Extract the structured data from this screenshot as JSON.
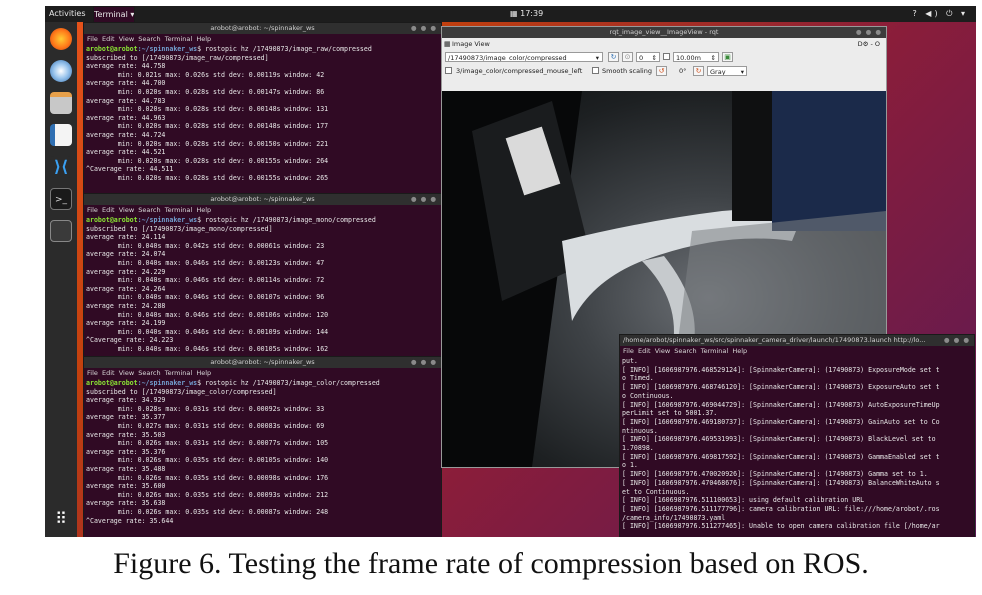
{
  "topbar": {
    "activities": "Activities",
    "terminal_menu": "Terminal ▾",
    "clock": "17:39",
    "tray": "? ◀) ⏻ ▾"
  },
  "dock": {
    "apps_grid_glyph": "⠿"
  },
  "terminal1": {
    "title": "arobot@arobot: ~/spinnaker_ws",
    "menu": "File  Edit  View  Search  Terminal  Help",
    "prompt_user": "arobot@arobot",
    "prompt_path": ":~/spinnaker_ws",
    "command": "$ rostopic hz /17490873/image_raw/compressed",
    "lines": [
      "subscribed to [/17490873/image_raw/compressed]",
      "average rate: 44.758",
      "        min: 0.021s max: 0.026s std dev: 0.00119s window: 42",
      "average rate: 44.700",
      "        min: 0.020s max: 0.028s std dev: 0.00147s window: 86",
      "average rate: 44.783",
      "        min: 0.020s max: 0.028s std dev: 0.00148s window: 131",
      "average rate: 44.963",
      "        min: 0.020s max: 0.028s std dev: 0.00148s window: 177",
      "average rate: 44.724",
      "        min: 0.020s max: 0.028s std dev: 0.00150s window: 221",
      "average rate: 44.521",
      "        min: 0.020s max: 0.028s std dev: 0.00155s window: 264",
      "^Caverage rate: 44.511",
      "        min: 0.020s max: 0.028s std dev: 0.00155s window: 265"
    ]
  },
  "terminal2": {
    "title": "arobot@arobot: ~/spinnaker_ws",
    "menu": "File  Edit  View  Search  Terminal  Help",
    "prompt_user": "arobot@arobot",
    "prompt_path": ":~/spinnaker_ws",
    "command": "$ rostopic hz /17490873/image_mono/compressed",
    "lines": [
      "subscribed to [/17490873/image_mono/compressed]",
      "average rate: 24.114",
      "        min: 0.040s max: 0.042s std dev: 0.00061s window: 23",
      "average rate: 24.074",
      "        min: 0.040s max: 0.046s std dev: 0.00123s window: 47",
      "average rate: 24.229",
      "        min: 0.040s max: 0.046s std dev: 0.00114s window: 72",
      "average rate: 24.264",
      "        min: 0.040s max: 0.046s std dev: 0.00107s window: 96",
      "average rate: 24.288",
      "        min: 0.040s max: 0.046s std dev: 0.00106s window: 120",
      "average rate: 24.199",
      "        min: 0.040s max: 0.046s std dev: 0.00109s window: 144",
      "^Caverage rate: 24.223",
      "        min: 0.040s max: 0.046s std dev: 0.00105s window: 162"
    ]
  },
  "terminal3": {
    "title": "arobot@arobot: ~/spinnaker_ws",
    "menu": "File  Edit  View  Search  Terminal  Help",
    "prompt_user": "arobot@arobot",
    "prompt_path": ":~/spinnaker_ws",
    "command": "$ rostopic hz /17490873/image_color/compressed",
    "lines": [
      "subscribed to [/17490873/image_color/compressed]",
      "average rate: 34.929",
      "        min: 0.028s max: 0.031s std dev: 0.00092s window: 33",
      "average rate: 35.377",
      "        min: 0.027s max: 0.031s std dev: 0.00083s window: 69",
      "average rate: 35.503",
      "        min: 0.026s max: 0.031s std dev: 0.00077s window: 105",
      "average rate: 35.376",
      "        min: 0.026s max: 0.035s std dev: 0.00105s window: 140",
      "average rate: 35.488",
      "        min: 0.026s max: 0.035s std dev: 0.00098s window: 176",
      "average rate: 35.600",
      "        min: 0.026s max: 0.035s std dev: 0.00093s window: 212",
      "average rate: 35.638",
      "        min: 0.026s max: 0.035s std dev: 0.00087s window: 248",
      "^Caverage rate: 35.644"
    ]
  },
  "rqt": {
    "title": "rqt_image_view__ImageView - rqt",
    "plugin_label": "Image View",
    "plugin_ctrls": "D⚙ - O",
    "topic": "/17490873/image_color/compressed",
    "spin_value": "0",
    "scale_value": "10.00m",
    "mouse_topic": "3/image_color/compressed_mouse_left",
    "smooth_label": "Smooth scaling",
    "rotation": "0°",
    "color_scheme": "Gray"
  },
  "launch": {
    "title": "/home/arobot/spinnaker_ws/src/spinnaker_camera_driver/launch/17490873.launch http://lo...",
    "menu": "File  Edit  View  Search  Terminal  Help",
    "lines": [
      "put.",
      "[ INFO] [1606987976.468529124]: [SpinnakerCamera]: (17490873) ExposureMode set t",
      "o Timed.",
      "[ INFO] [1606987976.468746120]: [SpinnakerCamera]: (17490873) ExposureAuto set t",
      "o Continuous.",
      "[ INFO] [1606987976.469044729]: [SpinnakerCamera]: (17490873) AutoExposureTimeUp",
      "perLimit set to 5001.37.",
      "[ INFO] [1606987976.469180737]: [SpinnakerCamera]: (17490873) GainAuto set to Co",
      "ntinuous.",
      "[ INFO] [1606987976.469531993]: [SpinnakerCamera]: (17490873) BlackLevel set to",
      "1.70898.",
      "[ INFO] [1606987976.469817592]: [SpinnakerCamera]: (17490873) GammaEnabled set t",
      "o 1.",
      "[ INFO] [1606987976.470020926]: [SpinnakerCamera]: (17490873) Gamma set to 1.",
      "[ INFO] [1606987976.470468676]: [SpinnakerCamera]: (17490873) BalanceWhiteAuto s",
      "et to Continuous.",
      "[ INFO] [1606987976.511100653]: using default calibration URL",
      "[ INFO] [1606987976.511177796]: camera calibration URL: file:///home/arobot/.ros",
      "/camera_info/17490873.yaml",
      "[ INFO] [1606987976.511277465]: Unable to open camera calibration file [/home/ar"
    ]
  },
  "caption": "Figure 6. Testing the frame rate of compression based on ROS."
}
